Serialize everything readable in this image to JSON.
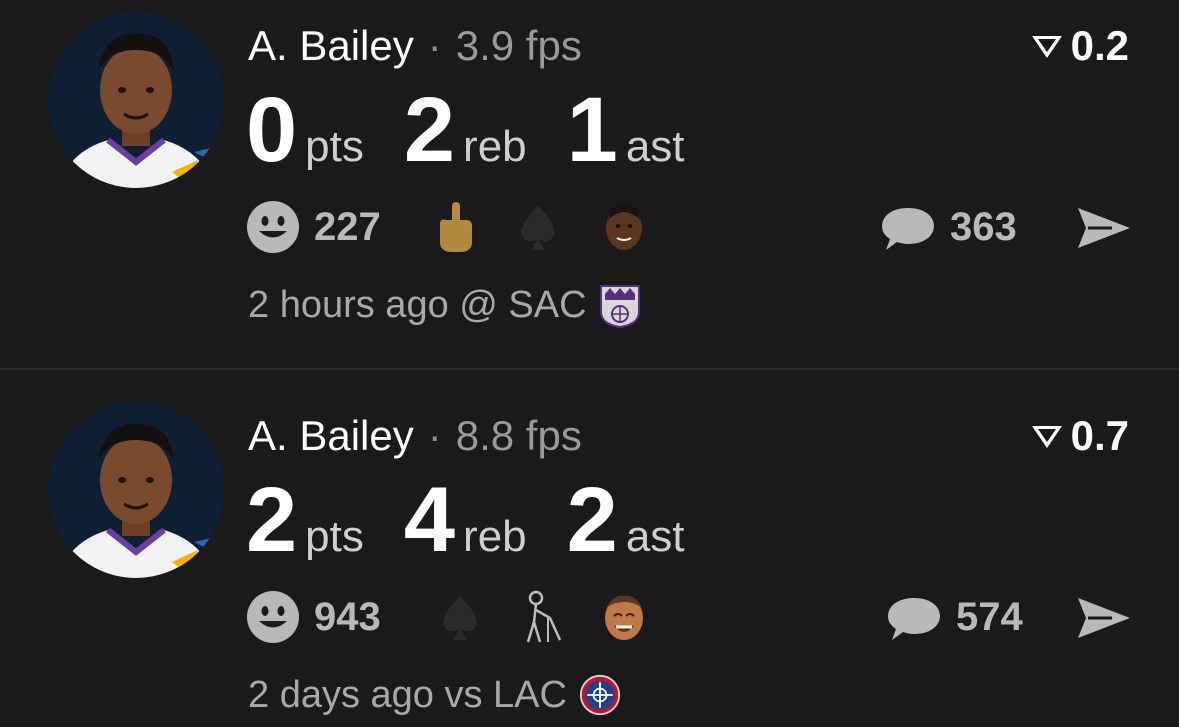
{
  "posts": [
    {
      "player": "A. Bailey",
      "fps": "3.9 fps",
      "score": "0.2",
      "stats": [
        {
          "value": "0",
          "label": "pts"
        },
        {
          "value": "2",
          "label": "reb"
        },
        {
          "value": "1",
          "label": "ast"
        }
      ],
      "reactions": "227",
      "comments": "363",
      "meta": "2 hours ago @ SAC",
      "team": "SAC",
      "icons": [
        "smiley-icon",
        "middle-finger-emoji",
        "spade-emoji",
        "player-face-emoji",
        "comment-icon",
        "share-icon"
      ]
    },
    {
      "player": "A. Bailey",
      "fps": "8.8 fps",
      "score": "0.7",
      "stats": [
        {
          "value": "2",
          "label": "pts"
        },
        {
          "value": "4",
          "label": "reb"
        },
        {
          "value": "2",
          "label": "ast"
        }
      ],
      "reactions": "943",
      "comments": "574",
      "meta": "2 days ago vs LAC",
      "team": "LAC",
      "icons": [
        "smiley-icon",
        "spade-emoji",
        "old-man-walker-emoji",
        "laughing-man-emoji",
        "comment-icon",
        "share-icon"
      ]
    }
  ],
  "colors": {
    "background": "#1a1a1a",
    "text_primary": "#ffffff",
    "text_secondary": "#9a9a9a",
    "icon_gray": "#b9b9b9",
    "kings_purple": "#5a2d81",
    "jazz_navy": "#0e1e33"
  }
}
